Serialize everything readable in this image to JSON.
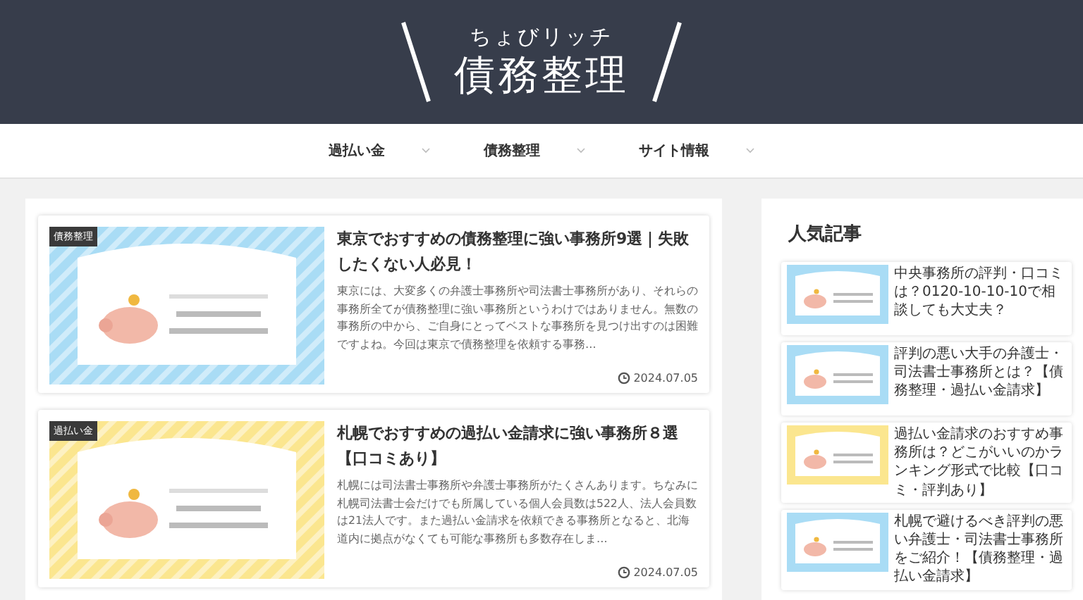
{
  "header": {
    "logo_subtitle": "ちょびリッチ",
    "logo_title": "債務整理"
  },
  "nav": {
    "items": [
      {
        "label": "過払い金"
      },
      {
        "label": "債務整理"
      },
      {
        "label": "サイト情報"
      }
    ]
  },
  "articles": [
    {
      "category": "債務整理",
      "title": "東京でおすすめの債務整理に強い事務所9選｜失敗したくない人必見！",
      "excerpt": "東京には、大変多くの弁護士事務所や司法書士事務所があり、それらの事務所全てが債務整理に強い事務所というわけではありません。無数の事務所の中から、ご自身にとってベストな事務所を見つけ出すのは困難ですよね。今回は東京で債務整理を依頼する事務…",
      "date": "2024.07.05"
    },
    {
      "category": "過払い金",
      "title": "札幌でおすすめの過払い金請求に強い事務所８選【口コミあり】",
      "excerpt": "札幌には司法書士事務所や弁護士事務所がたくさんあります。ちなみに札幌司法書士会だけでも所属している個人会員数は522人、法人会員数は21法人です。また過払い金請求を依頼できる事務所となると、北海道内に拠点がなくても可能な事務所も多数存在しま…",
      "date": "2024.07.05"
    }
  ],
  "sidebar": {
    "heading": "人気記事",
    "items": [
      {
        "title": "中央事務所の評判・口コミは？0120-10-10-10で相談しても大丈夫？"
      },
      {
        "title": "評判の悪い大手の弁護士・司法書士事務所とは？【債務整理・過払い金請求】"
      },
      {
        "title": "過払い金請求のおすすめ事務所は？どこがいいのかランキング形式で比較【口コミ・評判あり】"
      },
      {
        "title": "札幌で避けるべき評判の悪い弁護士・司法書士事務所をご紹介！【債務整理・過払い金請求】"
      }
    ]
  }
}
